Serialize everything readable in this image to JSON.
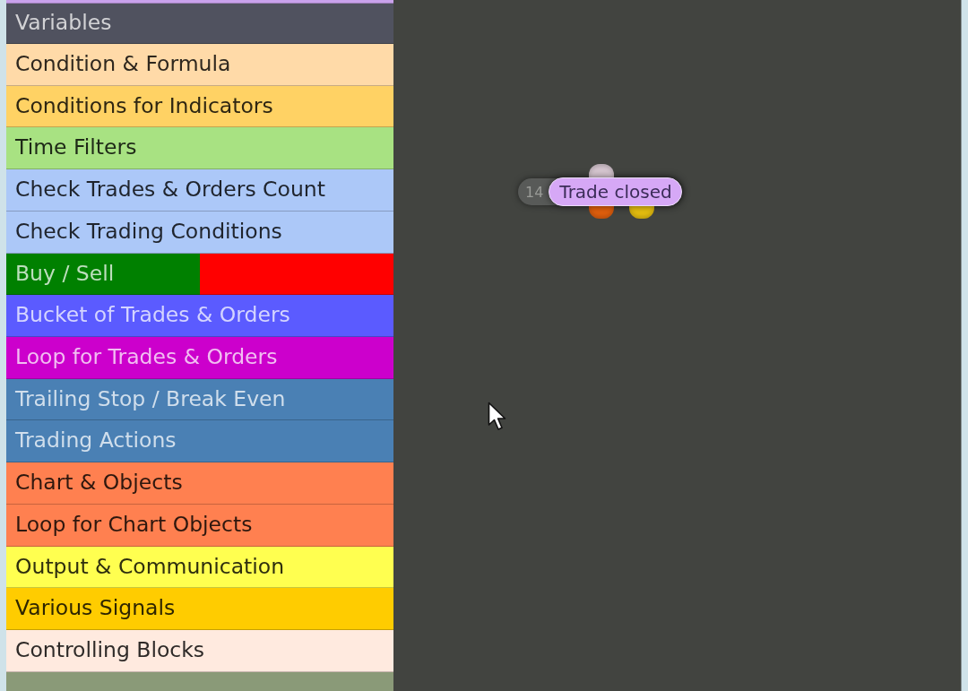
{
  "categories": [
    {
      "kind": "cut",
      "color": "#c9a2ec"
    },
    {
      "kind": "plain",
      "label": "Variables",
      "color": "#50525f"
    },
    {
      "kind": "plain",
      "label": "Condition & Formula",
      "color": "#ffdaa8"
    },
    {
      "kind": "plain",
      "label": "Conditions for Indicators",
      "color": "#ffd264"
    },
    {
      "kind": "plain",
      "label": "Time Filters",
      "color": "#a8e282"
    },
    {
      "kind": "plain",
      "label": "Check Trades & Orders Count",
      "color": "#acc8f8"
    },
    {
      "kind": "plain",
      "label": "Check Trading Conditions",
      "color": "#acc8f8"
    },
    {
      "kind": "split",
      "label": "Buy / Sell",
      "halves": [
        {
          "color": "#008000"
        },
        {
          "color": "#ff0000"
        }
      ]
    },
    {
      "kind": "plain",
      "label": "Bucket of Trades & Orders",
      "color": "#5b5bff"
    },
    {
      "kind": "plain",
      "label": "Loop for Trades & Orders",
      "color": "#cc00cc"
    },
    {
      "kind": "plain",
      "label": "Trailing Stop / Break Even",
      "color": "#4a80b4"
    },
    {
      "kind": "plain",
      "label": "Trading Actions",
      "color": "#4a80b4"
    },
    {
      "kind": "plain",
      "label": "Chart & Objects",
      "color": "#ff8050"
    },
    {
      "kind": "plain",
      "label": "Loop for Chart Objects",
      "color": "#ff8050"
    },
    {
      "kind": "plain",
      "label": "Output & Communication",
      "color": "#ffff50"
    },
    {
      "kind": "plain",
      "label": "Various Signals",
      "color": "#ffcc00"
    },
    {
      "kind": "plain",
      "label": "Controlling Blocks",
      "color": "#ffeadf"
    },
    {
      "kind": "cut",
      "color": "#8a9a78"
    }
  ],
  "canvas": {
    "node": {
      "number": "14",
      "label": "Trade closed",
      "color": "#d6a8f6",
      "ports": [
        {
          "kind": "input",
          "color": "#d8c8d2"
        },
        {
          "kind": "output",
          "color": "#e2600e"
        },
        {
          "kind": "output",
          "color": "#e8c010"
        }
      ]
    }
  }
}
